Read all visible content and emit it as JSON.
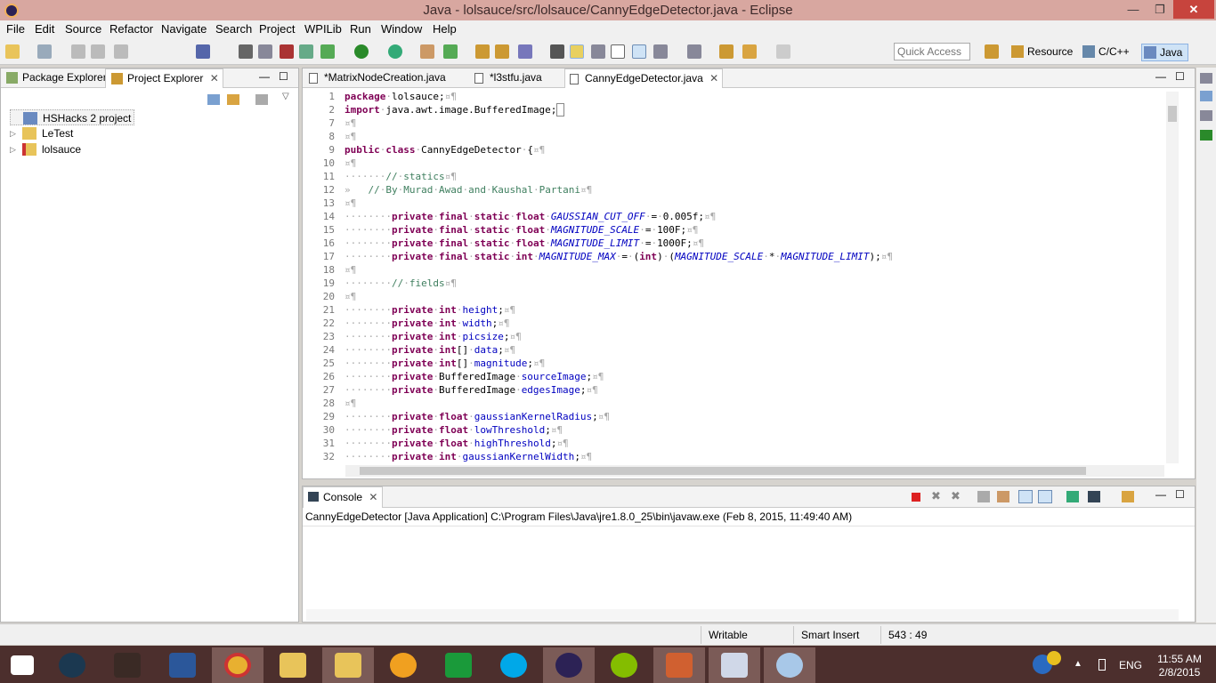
{
  "window": {
    "title": "Java - lolsauce/src/lolsauce/CannyEdgeDetector.java - Eclipse",
    "min_glyph": "—",
    "max_glyph": "❐",
    "close_glyph": "✕"
  },
  "menu": [
    "File",
    "Edit",
    "Source",
    "Refactor",
    "Navigate",
    "Search",
    "Project",
    "WPILib",
    "Run",
    "Window",
    "Help"
  ],
  "toolbar": {
    "quick_access_placeholder": "Quick Access",
    "perspectives": [
      {
        "label": "Resource",
        "icon": "resource-perspective-icon"
      },
      {
        "label": "C/C++",
        "icon": "cpp-perspective-icon"
      },
      {
        "label": "Java",
        "icon": "java-perspective-icon",
        "active": true
      }
    ]
  },
  "left_panel": {
    "tabs": [
      {
        "label": "Package Explorer",
        "active": false
      },
      {
        "label": "Project Explorer",
        "active": true
      }
    ],
    "tree": [
      {
        "label": "HSHacks 2 project",
        "expandable": false
      },
      {
        "label": "LeTest",
        "expandable": true
      },
      {
        "label": "lolsauce",
        "expandable": true
      }
    ]
  },
  "editor": {
    "tabs": [
      {
        "label": "*MatrixNodeCreation.java",
        "active": false
      },
      {
        "label": "*l3stfu.java",
        "active": false
      },
      {
        "label": "CannyEdgeDetector.java",
        "active": true
      }
    ],
    "line_numbers": [
      "1",
      "2",
      "7",
      "8",
      "9",
      "10",
      "11",
      "12",
      "13",
      "14",
      "15",
      "16",
      "17",
      "18",
      "19",
      "20",
      "21",
      "22",
      "23",
      "24",
      "25",
      "26",
      "27",
      "28",
      "29",
      "30",
      "31",
      "32"
    ]
  },
  "console": {
    "tab_label": "Console",
    "description": "CannyEdgeDetector [Java Application] C:\\Program Files\\Java\\jre1.8.0_25\\bin\\javaw.exe (Feb 8, 2015, 11:49:40 AM)"
  },
  "status": {
    "writable": "Writable",
    "insert_mode": "Smart Insert",
    "position": "543 : 49"
  },
  "taskbar": {
    "apps": [
      "start",
      "steam",
      "assassins-creed",
      "word",
      "chrome",
      "snipping-tool",
      "file-explorer",
      "audacity",
      "store",
      "skype",
      "eclipse",
      "spotify",
      "windows-photo",
      "network-app",
      "paint"
    ],
    "language": "ENG",
    "time": "11:55 AM",
    "date": "2/8/2015"
  },
  "colors": {
    "keyword": "#7f0055",
    "comment": "#3f7f5f",
    "field": "#0000c0",
    "title_bar": "#d8a7a0",
    "taskbar": "#4c2f2d"
  }
}
